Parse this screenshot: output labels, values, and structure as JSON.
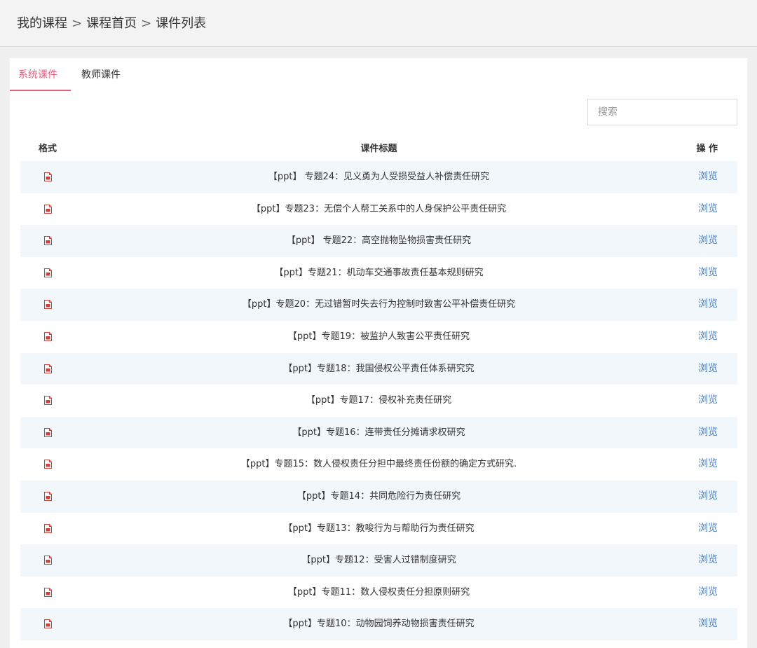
{
  "breadcrumb": {
    "items": [
      "我的课程",
      "课程首页",
      "课件列表"
    ],
    "separator": ">"
  },
  "tabs": [
    {
      "label": "系统课件",
      "active": true
    },
    {
      "label": "教师课件",
      "active": false
    }
  ],
  "search": {
    "placeholder": "搜索",
    "value": ""
  },
  "table": {
    "headers": {
      "format": "格式",
      "title": "课件标题",
      "action": "操 作"
    },
    "rows": [
      {
        "format_icon": "ppt-file-icon",
        "title": "【ppt】 专题24：见义勇为人受损受益人补偿责任研究",
        "action": "浏览"
      },
      {
        "format_icon": "ppt-file-icon",
        "title": "【ppt】专题23：无偿个人帮工关系中的人身保护公平责任研究",
        "action": "浏览"
      },
      {
        "format_icon": "ppt-file-icon",
        "title": "【ppt】 专题22：高空抛物坠物损害责任研究",
        "action": "浏览"
      },
      {
        "format_icon": "ppt-file-icon",
        "title": "【ppt】专题21：机动车交通事故责任基本规则研究",
        "action": "浏览"
      },
      {
        "format_icon": "ppt-file-icon",
        "title": "【ppt】专题20：无过错暂时失去行为控制时致害公平补偿责任研究",
        "action": "浏览"
      },
      {
        "format_icon": "ppt-file-icon",
        "title": "【ppt】专题19：被监护人致害公平责任研究",
        "action": "浏览"
      },
      {
        "format_icon": "ppt-file-icon",
        "title": "【ppt】专题18：我国侵权公平责任体系研究究",
        "action": "浏览"
      },
      {
        "format_icon": "ppt-file-icon",
        "title": "【ppt】专题17：侵权补充责任研究",
        "action": "浏览"
      },
      {
        "format_icon": "ppt-file-icon",
        "title": "【ppt】专题16：连带责任分摊请求权研究",
        "action": "浏览"
      },
      {
        "format_icon": "ppt-file-icon",
        "title": "【ppt】专题15：数人侵权责任分担中最终责任份额的确定方式研究.",
        "action": "浏览"
      },
      {
        "format_icon": "ppt-file-icon",
        "title": "【ppt】专题14：共同危险行为责任研究",
        "action": "浏览"
      },
      {
        "format_icon": "ppt-file-icon",
        "title": "【ppt】专题13：教唆行为与帮助行为责任研究",
        "action": "浏览"
      },
      {
        "format_icon": "ppt-file-icon",
        "title": "【ppt】专题12：受害人过错制度研究",
        "action": "浏览"
      },
      {
        "format_icon": "ppt-file-icon",
        "title": "【ppt】专题11：数人侵权责任分担原则研究",
        "action": "浏览"
      },
      {
        "format_icon": "ppt-file-icon",
        "title": "【ppt】专题10：动物园饲养动物损害责任研究",
        "action": "浏览"
      }
    ]
  },
  "colors": {
    "accent": "#e0607e",
    "link": "#4a7fc0",
    "stripe": "#f2f7fc",
    "file_icon": "#c9413a"
  }
}
